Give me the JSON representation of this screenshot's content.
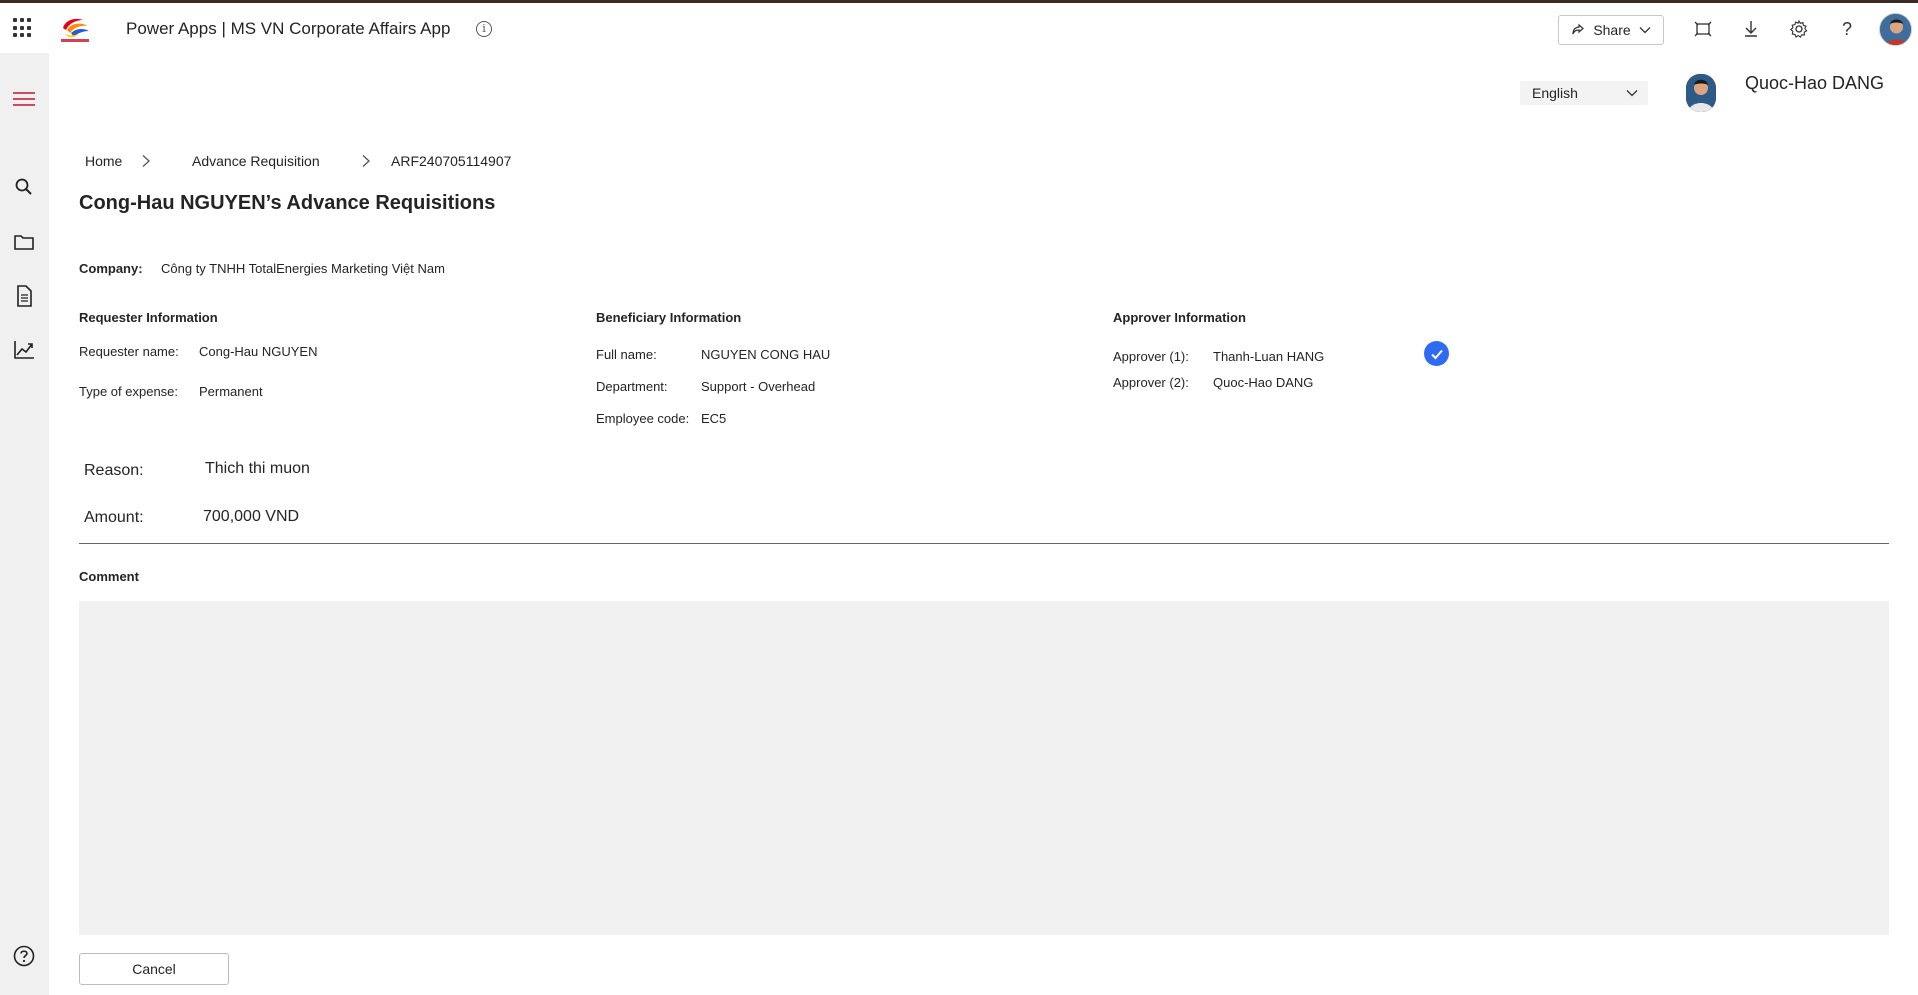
{
  "topbar": {
    "app_title": "Power Apps  |  MS VN Corporate Affairs App",
    "share_label": "Share"
  },
  "header": {
    "language": "English",
    "user_name": "Quoc-Hao DANG"
  },
  "breadcrumb": {
    "home": "Home",
    "section": "Advance Requisition",
    "current": "ARF240705114907"
  },
  "page": {
    "title": "Cong-Hau NGUYEN’s Advance Requisitions"
  },
  "company": {
    "label": "Company:",
    "value": "Công ty TNHH TotalEnergies Marketing Việt Nam"
  },
  "requester": {
    "title": "Requester Information",
    "name_label": "Requester name:",
    "name_value": "Cong-Hau NGUYEN",
    "expense_label": "Type of expense:",
    "expense_value": "Permanent"
  },
  "beneficiary": {
    "title": "Beneficiary Information",
    "fullname_label": "Full name:",
    "fullname_value": "NGUYEN CONG HAU",
    "department_label": "Department:",
    "department_value": "Support - Overhead",
    "empcode_label": "Employee code:",
    "empcode_value": "EC5"
  },
  "approver": {
    "title": "Approver Information",
    "approver1_label": "Approver (1):",
    "approver1_value": "Thanh-Luan HANG",
    "approver2_label": "Approver (2):",
    "approver2_value": "Quoc-Hao DANG"
  },
  "details": {
    "reason_label": "Reason:",
    "reason_value": "Thich thi muon",
    "amount_label": "Amount:",
    "amount_value": "700,000 VND"
  },
  "comment": {
    "label": "Comment",
    "value": ""
  },
  "actions": {
    "cancel_label": "Cancel"
  },
  "colors": {
    "accent_blue": "#2f6bf2",
    "rail_bg": "#f0f0f0",
    "menu_red": "#c8102e"
  }
}
